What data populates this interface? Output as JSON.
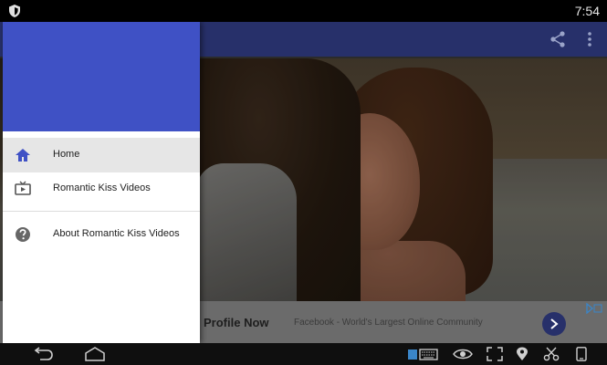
{
  "status_bar": {
    "time": "7:54",
    "icons": [
      "shield-icon"
    ]
  },
  "app_bar": {
    "icons": [
      "share-icon",
      "more-vertical-icon"
    ]
  },
  "drawer": {
    "items": [
      {
        "label": "Home",
        "icon": "home-icon",
        "active": true
      },
      {
        "label": "Romantic Kiss Videos",
        "icon": "tv-icon",
        "active": false
      },
      {
        "label": "About Romantic Kiss Videos",
        "icon": "help-icon",
        "active": false
      }
    ]
  },
  "ad": {
    "title": "Profile Now",
    "subtitle": "Facebook - World's Largest Online Community",
    "icons": [
      "arrow-right-icon",
      "adchoices-icon"
    ]
  },
  "system_nav": {
    "icons": [
      "back-icon",
      "home-outline-icon",
      "keyboard-icon",
      "eye-icon",
      "fullscreen-icon",
      "location-icon",
      "scissors-icon",
      "rotate-icon"
    ]
  },
  "colors": {
    "drawer_header": "#3f51c5",
    "app_bar": "#27306a",
    "active_item": "#e6e6e6"
  }
}
